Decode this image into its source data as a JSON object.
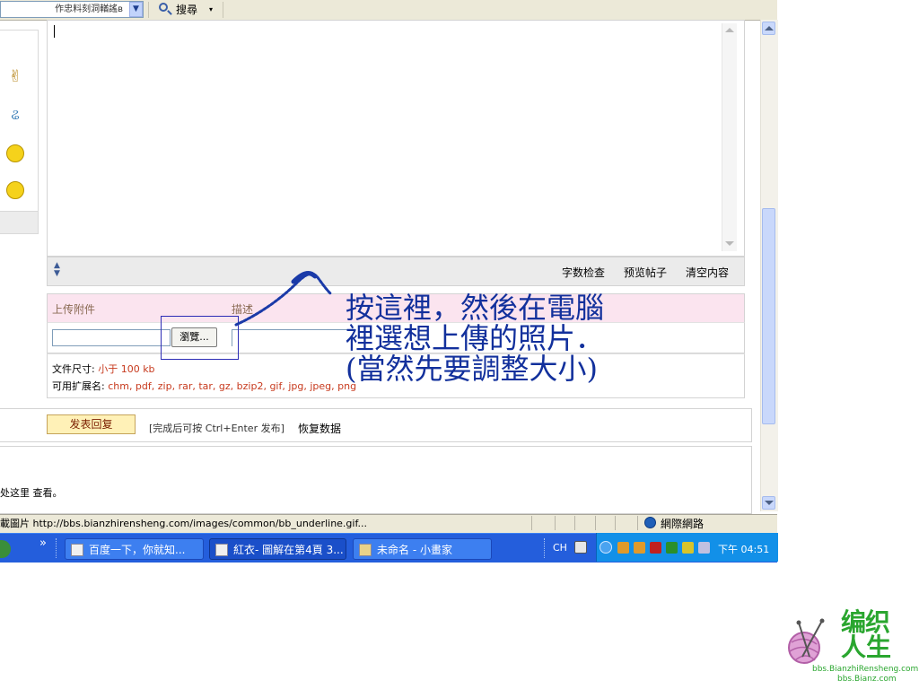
{
  "toolbar": {
    "address_text": "作忠料刻洞輶謠в",
    "search_label": "搜尋",
    "search_dropdown": "▾"
  },
  "editor": {
    "word_count": "字数检查",
    "preview": "预览帖子",
    "clear": "清空内容"
  },
  "attachments": {
    "upload_label": "上传附件",
    "desc_label": "描述",
    "browse_button": "瀏覽...",
    "size_prefix": "文件尺寸: ",
    "size_value": "小于  100 kb",
    "ext_prefix": "可用扩展名: ",
    "ext_value": "chm, pdf, zip, rar, tar, gz, bzip2, gif, jpg, jpeg, png"
  },
  "submit": {
    "button": "发表回复",
    "hint": "[完成后可按  Ctrl+Enter 发布]",
    "restore": "恢复数据"
  },
  "lower_text": "处这里 查看。",
  "statusbar": {
    "text": "載圖片 http://bbs.bianzhirensheng.com/images/common/bb_underline.gif...",
    "zone": "網際網路"
  },
  "taskbar": {
    "chevron": "»",
    "tasks": [
      "百度一下，你就知...",
      "紅衣- 圖解在第4頁 3...",
      "未命名 - 小畫家"
    ],
    "lang": "CH",
    "clock": "下午 04:51"
  },
  "annotation": {
    "line1": "按這裡，然後在電腦",
    "line2": "裡選想上傳的照片．",
    "line3": "(當然先要調整大小)"
  },
  "logo": {
    "line1": "编织",
    "line2": "人生",
    "url1": "bbs.BianzhiRensheng.com",
    "url2": "bbs.Bianz.com"
  },
  "colors": {
    "annotation": "#12309c",
    "taskbar": "#245edc",
    "logo": "#2aa62f"
  }
}
